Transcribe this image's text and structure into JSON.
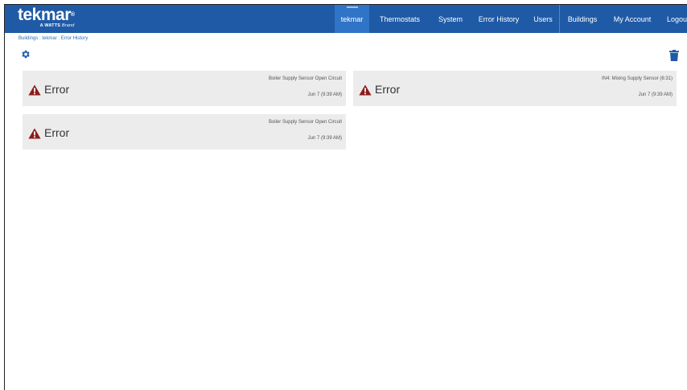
{
  "logo": {
    "word": "tekmar",
    "reg": "®",
    "brand": "A WATTS",
    "brand_italic": "Brand"
  },
  "nav": {
    "tekmar": "tekmar",
    "thermostats": "Thermostats",
    "system": "System",
    "error_history": "Error History",
    "users": "Users",
    "buildings": "Buildings",
    "my_account": "My Account",
    "logout": "Logout"
  },
  "breadcrumb": "Buildings : tekmar : Error History",
  "icons": {
    "settings": "gear-icon",
    "delete": "trash-icon",
    "error": "warning-triangle-icon"
  },
  "colors": {
    "topbar": "#1f5aa6",
    "active_tab": "#2f74c6",
    "accent": "#1f5aa6",
    "error": "#8b1c1c",
    "card_bg": "#ececec"
  },
  "errors": [
    {
      "title": "Error",
      "description": "Boiler Supply Sensor Open Circuit",
      "time": "Jun 7 (9:39 AM)"
    },
    {
      "title": "Error",
      "description": "IN4: Mixing Supply Sensor (6:31)",
      "time": "Jun 7 (9:39 AM)"
    },
    {
      "title": "Error",
      "description": "Boiler Supply Sensor Open Circuit",
      "time": "Jun 7 (9:39 AM)"
    }
  ]
}
